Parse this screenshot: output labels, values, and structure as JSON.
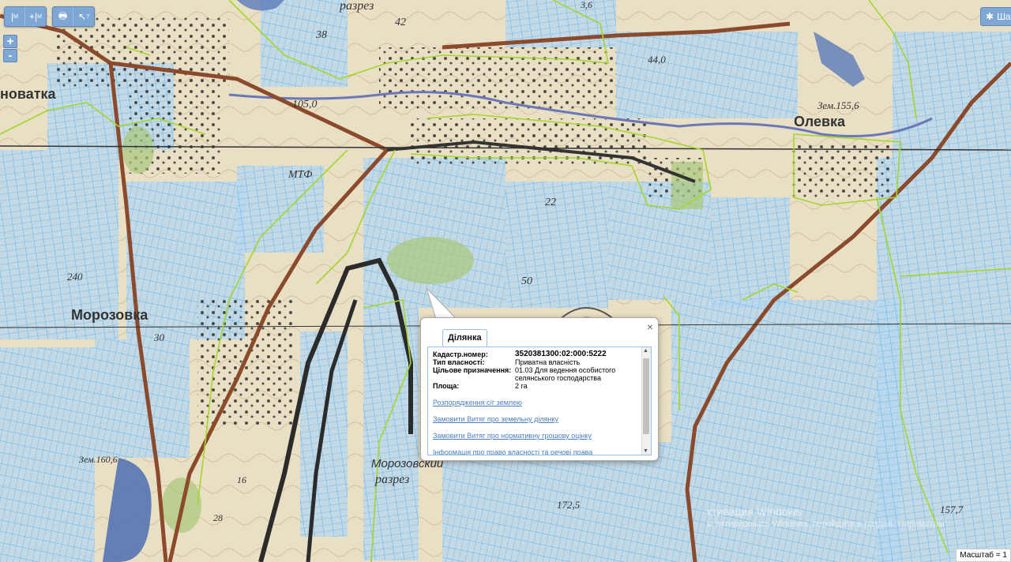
{
  "toolbar": {
    "measure_label": "M",
    "measure_area_label": "M",
    "print_label": "🖶",
    "identify_label": "?"
  },
  "zoom": {
    "in_label": "+",
    "out_label": "-"
  },
  "share": {
    "label": "Шар"
  },
  "map_labels": {
    "razrez_top": "разрез",
    "n42": "42",
    "n38": "38",
    "n41": "3,6",
    "n35": "44,0",
    "n58": "Зем.155,6",
    "olevka": "Олевка",
    "n105": "105,0",
    "mtf": "МТФ",
    "n22": "22",
    "n50": "50",
    "n30": "30",
    "morozovka": "Морозовка",
    "n240": "240",
    "novatka": "нoватка",
    "n1725": "172,5",
    "razrez_bottom": "разрез",
    "morozovsky": "Морозовский",
    "n16": "16",
    "n28": "28",
    "n1625": "157,7",
    "zem160": "Зем.160,6"
  },
  "popup": {
    "tab": "Ділянка",
    "fields": [
      {
        "label": "Кадастр.номер:",
        "value": "3520381300:02:000:5222"
      },
      {
        "label": "Тип власності:",
        "value": "Приватна власність"
      },
      {
        "label": "Цільове призначення:",
        "value": "01.03 Для ведення особистого селянського господарства"
      },
      {
        "label": "Площа:",
        "value": "2 га"
      }
    ],
    "links": [
      "Розпорядження с/г землею",
      "Замовити Витяг про земельну ділянку",
      "Замовити Витяг про нормативну грошову оцінку",
      "Інформація про право власності та речові права"
    ],
    "close": "×"
  },
  "watermark": {
    "line1": "ктивация Windows",
    "line2": "ы активировать Windows, перейдите в раздел \"Параметры\""
  },
  "scale": "Масштаб = 1",
  "colors": {
    "map_bg": "#e9dfc4",
    "parcel_fill": "#b9d8ee",
    "parcel_line": "#5fb2e8",
    "boundary": "#a4d62b",
    "road": "#8b4a2c",
    "river": "#6b78b8"
  }
}
